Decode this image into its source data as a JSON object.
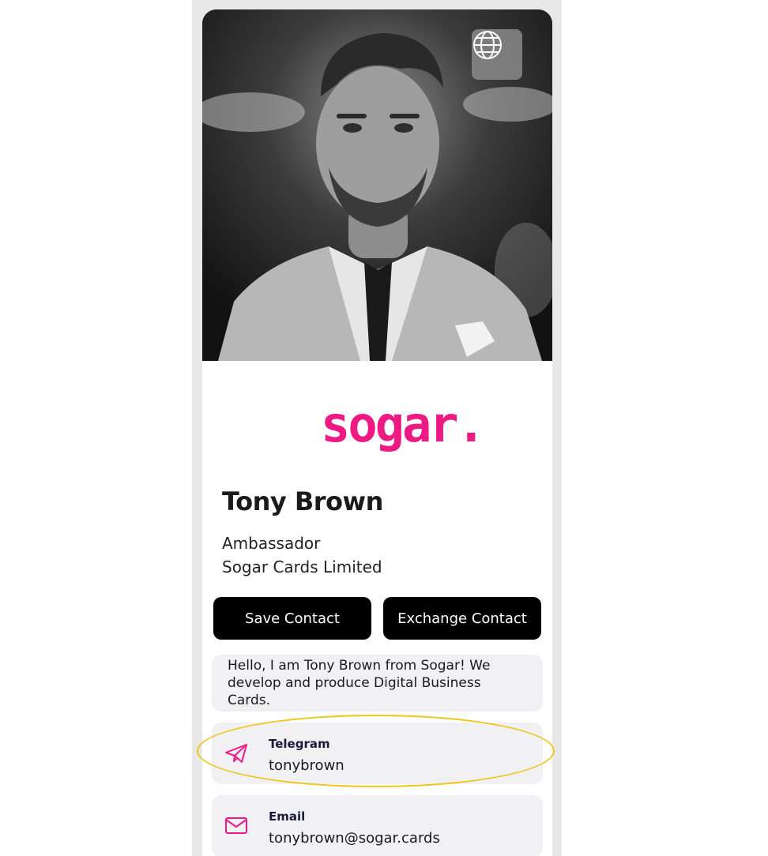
{
  "profile": {
    "name": "Tony Brown",
    "role": "Ambassador",
    "company": "Sogar Cards Limited",
    "brand_logo_text": "sogar."
  },
  "actions": {
    "save_label": "Save Contact",
    "exchange_label": "Exchange Contact"
  },
  "bio": "Hello, I am Tony Brown from Sogar! We develop and produce Digital Business Cards.",
  "contacts": [
    {
      "label": "Telegram",
      "value": "tonybrown",
      "icon": "telegram-icon"
    },
    {
      "label": "Email",
      "value": "tonybrown@sogar.cards",
      "icon": "email-icon"
    }
  ],
  "header": {
    "language_icon": "globe-icon"
  },
  "colors": {
    "brand": "#ee1a84",
    "button_bg": "#000000",
    "card_bg": "#f1f1f3",
    "highlight": "#f2c418"
  }
}
